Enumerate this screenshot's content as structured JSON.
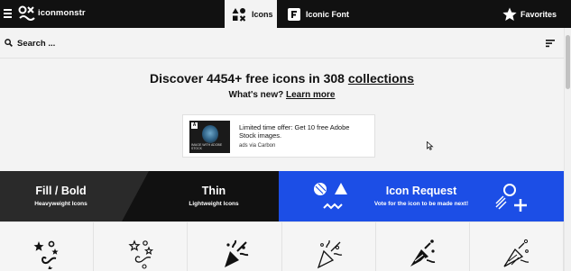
{
  "topbar": {
    "logo_text": "iconmonstr",
    "tabs": [
      {
        "label": "Icons",
        "icon": "shapes-icon",
        "active": true
      },
      {
        "label": "Iconic Font",
        "icon": "font-icon",
        "active": false
      }
    ],
    "favorites_label": "Favorites"
  },
  "search": {
    "placeholder": "Search ...",
    "value": ""
  },
  "hero": {
    "headline_prefix": "Discover 4454+ free icons in 308 ",
    "headline_link": "collections",
    "whatsnew_prefix": "What's new? ",
    "whatsnew_link": "Learn more"
  },
  "ad": {
    "text": "Limited time offer: Get 10 free Adobe Stock images.",
    "via": "ads via Carbon",
    "thumb_logo": "A",
    "thumb_caption": "IMAGE WITH ADOBE STOCK"
  },
  "banners": {
    "fill": {
      "title": "Fill / Bold",
      "subtitle": "Heavyweight Icons"
    },
    "thin": {
      "title": "Thin",
      "subtitle": "Lightweight Icons"
    },
    "request": {
      "title": "Icon Request",
      "subtitle": "Vote for the icon to be made next!"
    }
  },
  "grid": {
    "icons": [
      "party-stars-icon",
      "party-stars-thin-icon",
      "party-popper-icon",
      "party-popper-thin-icon",
      "party-horn-icon",
      "party-horn-thin-icon"
    ]
  },
  "colors": {
    "topbar": "#111111",
    "accent_blue": "#1c4ee6",
    "fill_banner": "#2a2a2a",
    "thin_banner": "#111111"
  }
}
